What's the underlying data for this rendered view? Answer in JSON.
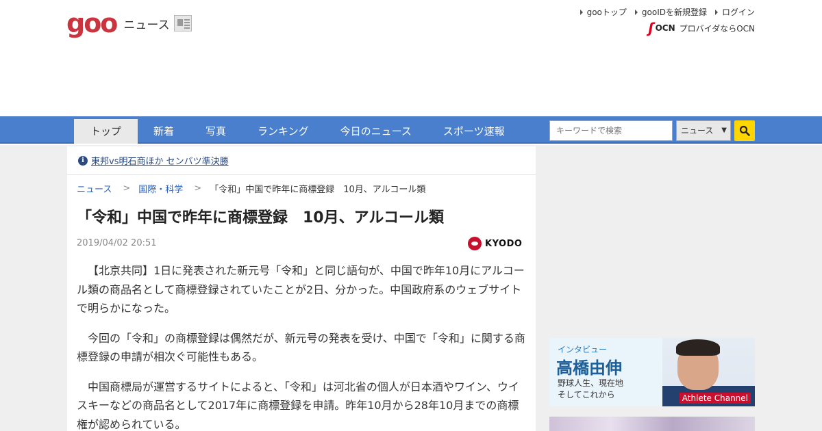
{
  "header": {
    "logo_text": "goo",
    "logo_section": "ニュース",
    "links": [
      "gooトップ",
      "gooIDを新規登録",
      "ログイン"
    ],
    "ocn_logo_text": "OCN",
    "ocn_tagline": "プロバイダならOCN"
  },
  "nav": {
    "tabs": [
      "トップ",
      "新着",
      "写真",
      "ランキング",
      "今日のニュース",
      "スポーツ速報"
    ],
    "active_tab": "トップ",
    "search_placeholder": "キーワードで検索",
    "search_scope": "ニュース"
  },
  "alert": {
    "text": "東邦vs明石商ほか センバツ準決勝"
  },
  "breadcrumb": {
    "items": [
      "ニュース",
      "国際・科学"
    ],
    "current": "「令和」中国で昨年に商標登録　10月、アルコール類"
  },
  "article": {
    "title": "「令和」中国で昨年に商標登録　10月、アルコール類",
    "date": "2019/04/02 20:51",
    "source": "KYODO",
    "paragraphs": [
      "【北京共同】1日に発表された新元号「令和」と同じ語句が、中国で昨年10月にアルコール類の商品名として商標登録されていたことが2日、分かった。中国政府系のウェブサイトで明らかになった。",
      "今回の「令和」の商標登録は偶然だが、新元号の発表を受け、中国で「令和」に関する商標登録の申請が相次ぐ可能性もある。",
      "中国商標局が運営するサイトによると、「令和」は河北省の個人が日本酒やワイン、ウイスキーなどの商品名として2017年に商標登録を申請。昨年10月から28年10月までの商標権が認められている。"
    ]
  },
  "sidebar": {
    "ad": {
      "tag": "インタビュー",
      "name": "高橋由伸",
      "sub1": "野球人生、現在地",
      "sub2": "そしてこれから",
      "brand": "Athlete Channel"
    }
  },
  "colors": {
    "nav_bg": "#4a7fcd",
    "logo_red": "#c8353f",
    "search_button": "#ffd600",
    "link_blue": "#2963c0"
  }
}
